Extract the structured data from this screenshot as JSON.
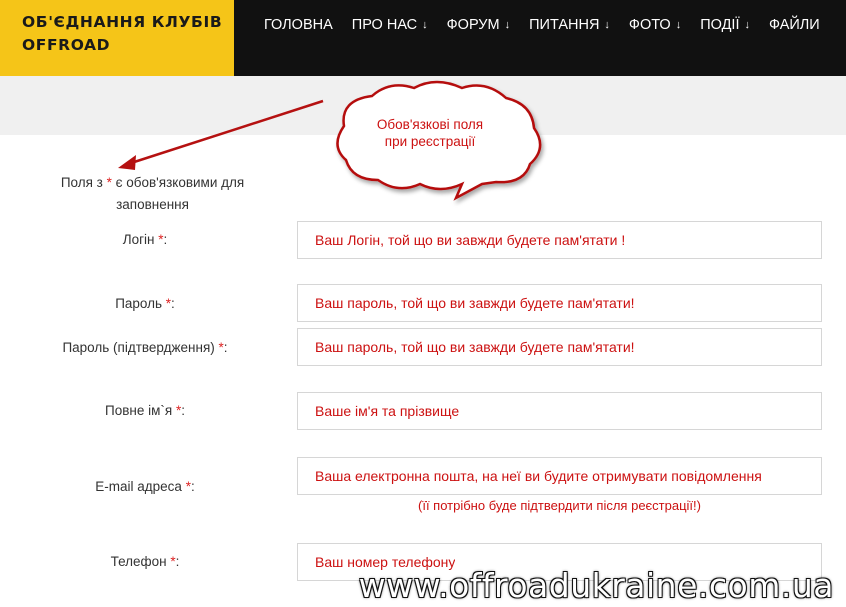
{
  "header": {
    "logo_line1": "ОБ'ЄДНАННЯ КЛУБІВ",
    "logo_line2": "OFFROAD",
    "nav": [
      {
        "label": "ГОЛОВНА",
        "arrow": ""
      },
      {
        "label": "ПРО НАС",
        "arrow": "↓"
      },
      {
        "label": "ФОРУМ",
        "arrow": "↓"
      },
      {
        "label": "ПИТАННЯ",
        "arrow": "↓"
      },
      {
        "label": "ФОТО",
        "arrow": "↓"
      },
      {
        "label": "ПОДІЇ",
        "arrow": "↓"
      },
      {
        "label": "ФАЙЛИ",
        "arrow": ""
      }
    ]
  },
  "callout": {
    "line1": "Обов'язкові поля",
    "line2": "при реєстрації"
  },
  "form": {
    "note_before": "Поля з ",
    "note_star": "*",
    "note_after": " є обов'язковими для заповнення",
    "star": "*",
    "fields": [
      {
        "label": "Логін ",
        "suffix": ":",
        "value": "Ваш Логін, той що ви завжди будете пам'ятати !"
      },
      {
        "label": "Пароль ",
        "suffix": ":",
        "value": "Ваш пароль, той що ви завжди будете пам'ятати!"
      },
      {
        "label": "Пароль (підтвердження) ",
        "suffix": ":",
        "value": "Ваш пароль, той що ви завжди будете пам'ятати!"
      },
      {
        "label": "Повне ім`я ",
        "suffix": ":",
        "value": "Ваше ім'я та прізвище"
      },
      {
        "label": "E-mail адреса ",
        "suffix": ":",
        "value": "Ваша електронна пошта, на неї ви будите отримувати повідомлення"
      },
      {
        "label": "Телефон ",
        "suffix": ":",
        "value": "Ваш номер телефону"
      }
    ],
    "email_hint": "(її потрібно буде підтвердити після реєстрації!)"
  },
  "watermark": "www.offroadukraine.com.ua",
  "colors": {
    "accent": "#f5c518",
    "header_bg": "#111111",
    "required": "#dd2222",
    "annotation": "#cc1111"
  }
}
